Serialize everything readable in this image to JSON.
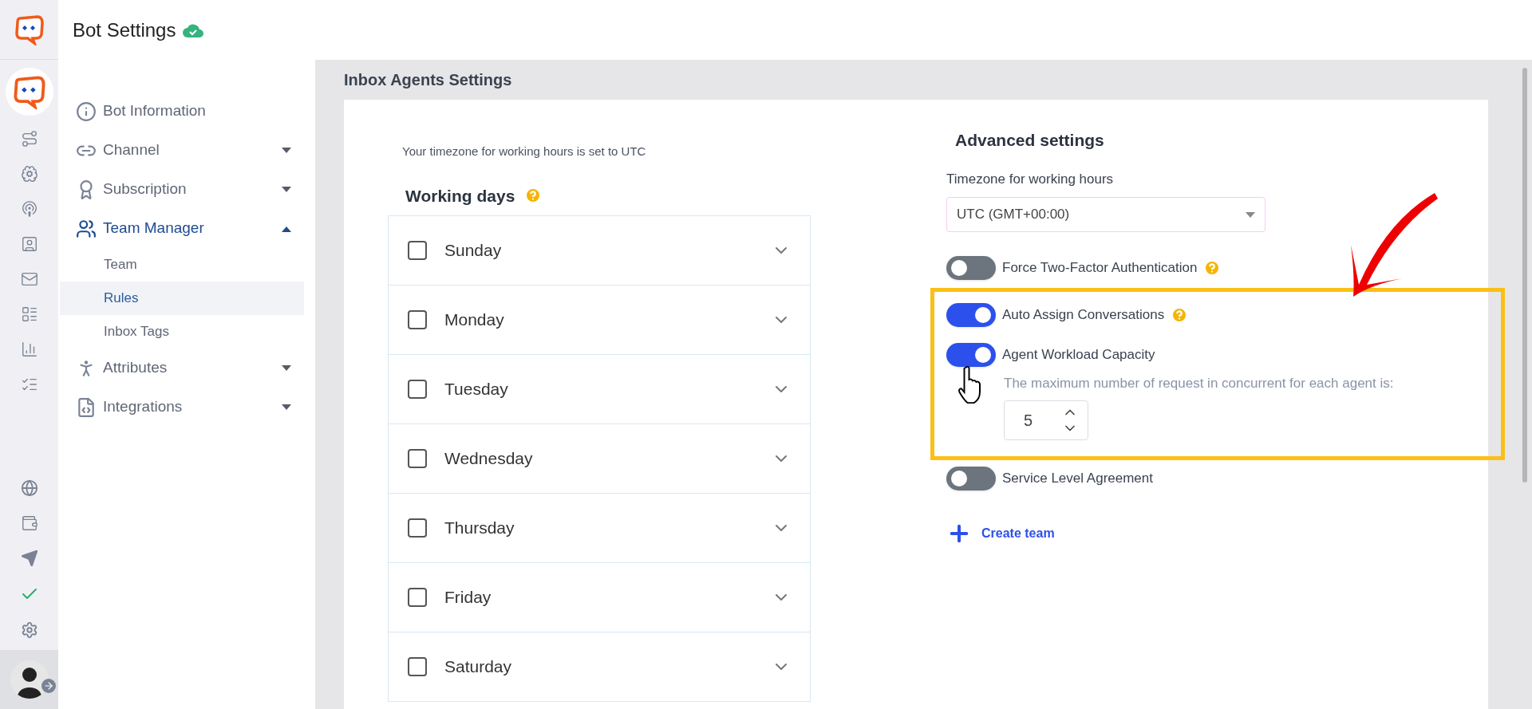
{
  "header": {
    "title": "Bot Settings",
    "synced": true
  },
  "sidebar": {
    "items": [
      {
        "label": "Bot Information",
        "selected": false
      },
      {
        "label": "Channel",
        "selected": false,
        "expanded": false
      },
      {
        "label": "Subscription",
        "selected": false,
        "expanded": false
      },
      {
        "label": "Team Manager",
        "selected": true,
        "expanded": true,
        "children": [
          {
            "label": "Team",
            "selected": false
          },
          {
            "label": "Rules",
            "selected": true
          },
          {
            "label": "Inbox Tags",
            "selected": false
          }
        ]
      },
      {
        "label": "Attributes",
        "selected": false,
        "expanded": false
      },
      {
        "label": "Integrations",
        "selected": false,
        "expanded": false
      }
    ]
  },
  "main": {
    "title": "Inbox Agents Settings",
    "timezone_note": "Your timezone for working hours is set to UTC",
    "working_days": {
      "title": "Working days",
      "help": true,
      "days": [
        {
          "label": "Sunday",
          "checked": false
        },
        {
          "label": "Monday",
          "checked": false
        },
        {
          "label": "Tuesday",
          "checked": false
        },
        {
          "label": "Wednesday",
          "checked": false
        },
        {
          "label": "Thursday",
          "checked": false
        },
        {
          "label": "Friday",
          "checked": false
        },
        {
          "label": "Saturday",
          "checked": false
        }
      ]
    },
    "advanced": {
      "title": "Advanced settings",
      "timezone_label": "Timezone for working hours",
      "timezone_value": "UTC (GMT+00:00)",
      "settings": [
        {
          "label": "Force Two-Factor Authentication",
          "on": false,
          "help": true
        }
      ],
      "highlighted_settings": [
        {
          "label": "Auto Assign Conversations",
          "on": true,
          "help": true
        },
        {
          "label": "Agent Workload Capacity",
          "on": true,
          "help": false,
          "capacity": {
            "description": "The maximum number of request in concurrent for each agent is:",
            "value": "5"
          }
        }
      ],
      "more_settings": [
        {
          "label": "Service Level Agreement",
          "on": false,
          "help": false
        }
      ],
      "create_team": "Create team"
    }
  }
}
